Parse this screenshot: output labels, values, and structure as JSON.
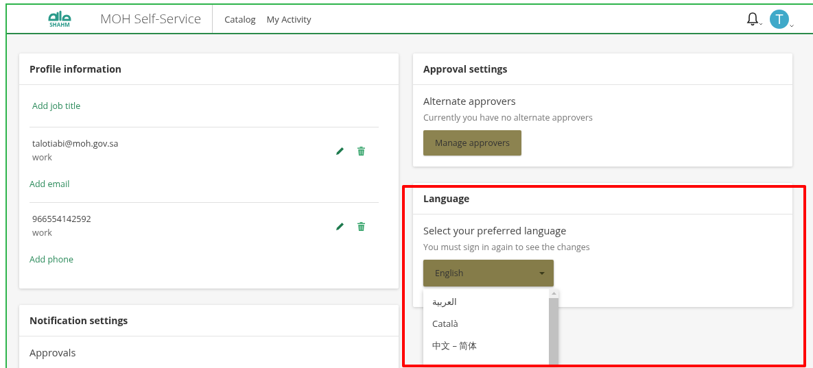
{
  "header": {
    "logo_caption": "SHAHM",
    "title": "MOH Self-Service",
    "nav": [
      {
        "label": "Catalog",
        "selected": false
      },
      {
        "label": "My Activity",
        "selected": false
      }
    ],
    "avatar_letter": "T"
  },
  "profile": {
    "title": "Profile information",
    "add_job_title": "Add job title",
    "entries": [
      {
        "value": "talotiabi@moh.gov.sa",
        "type": "work",
        "add_label": "Add email"
      },
      {
        "value": "966554142592",
        "type": "work",
        "add_label": "Add phone"
      }
    ]
  },
  "notifications": {
    "title": "Notification settings",
    "section": "Approvals"
  },
  "approval": {
    "title": "Approval settings",
    "heading": "Alternate approvers",
    "note": "Currently you have no alternate approvers",
    "button": "Manage approvers"
  },
  "language": {
    "title": "Language",
    "heading": "Select your preferred language",
    "note": "You must sign in again to see the changes",
    "value": "English",
    "expanded": true,
    "options": [
      {
        "label": "العربية",
        "selected": false
      },
      {
        "label": "Català",
        "selected": false
      },
      {
        "label": "中文 – 简体",
        "selected": false
      }
    ]
  }
}
